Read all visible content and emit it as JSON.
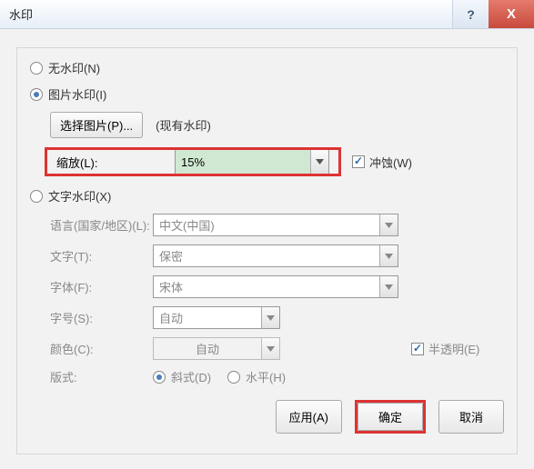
{
  "titlebar": {
    "title": "水印",
    "help": "?",
    "close": "X"
  },
  "radios": {
    "none": "无水印(N)",
    "picture": "图片水印(I)",
    "text": "文字水印(X)"
  },
  "picture": {
    "select_button": "选择图片(P)...",
    "existing": "(现有水印)",
    "scale_label": "缩放(L):",
    "scale_value": "15%",
    "washout_label": "冲蚀(W)"
  },
  "text": {
    "language_label": "语言(国家/地区)(L):",
    "language_value": "中文(中国)",
    "text_label": "文字(T):",
    "text_value": "保密",
    "font_label": "字体(F):",
    "font_value": "宋体",
    "size_label": "字号(S):",
    "size_value": "自动",
    "color_label": "颜色(C):",
    "color_value": "自动",
    "semitrans_label": "半透明(E)",
    "layout_label": "版式:",
    "diagonal": "斜式(D)",
    "horizontal": "水平(H)"
  },
  "buttons": {
    "apply": "应用(A)",
    "ok": "确定",
    "cancel": "取消"
  }
}
